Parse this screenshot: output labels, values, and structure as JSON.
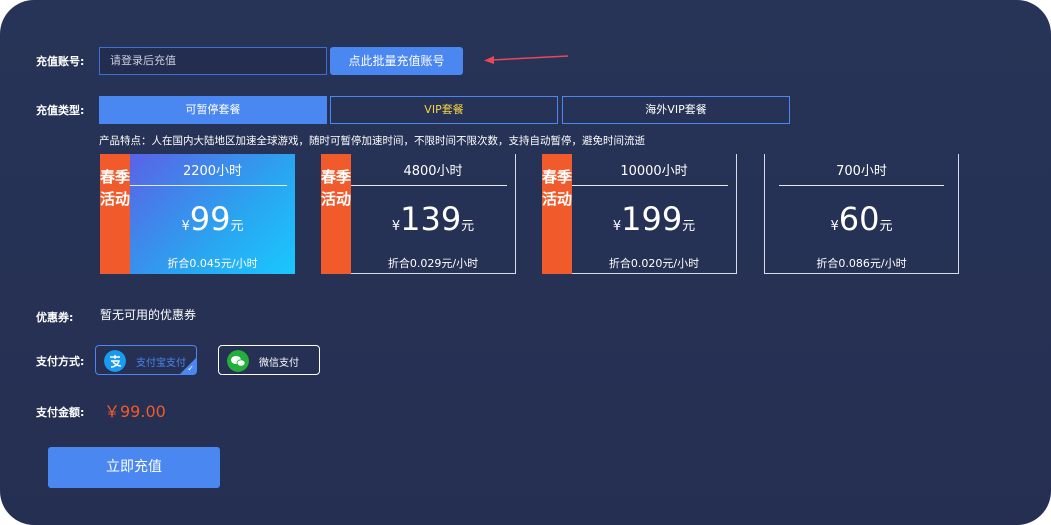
{
  "account": {
    "label": "充值账号:",
    "placeholder": "请登录后充值",
    "batch_button": "点此批量充值账号"
  },
  "type": {
    "label": "充值类型:",
    "tabs": [
      {
        "label": "可暂停套餐",
        "selected": true
      },
      {
        "label": "VIP套餐",
        "selected": false
      },
      {
        "label": "海外VIP套餐",
        "selected": false
      }
    ],
    "description": "产品特点：人在国内大陆地区加速全球游戏，随时可暂停加速时间，不限时间不限次数，支持自动暂停，避免时间流逝"
  },
  "packages": [
    {
      "badge": "春季活动",
      "hours": "2200小时",
      "yen": "¥",
      "price": "99",
      "unit": "元",
      "rate": "折合0.045元/小时",
      "selected": true
    },
    {
      "badge": "春季活动",
      "hours": "4800小时",
      "yen": "¥",
      "price": "139",
      "unit": "元",
      "rate": "折合0.029元/小时",
      "selected": false
    },
    {
      "badge": "春季活动",
      "hours": "10000小时",
      "yen": "¥",
      "price": "199",
      "unit": "元",
      "rate": "折合0.020元/小时",
      "selected": false
    },
    {
      "badge": "",
      "hours": "700小时",
      "yen": "¥",
      "price": "60",
      "unit": "元",
      "rate": "折合0.086元/小时",
      "selected": false
    }
  ],
  "coupon": {
    "label": "优惠券:",
    "value": "暂无可用的优惠券"
  },
  "payment": {
    "label": "支付方式:",
    "methods": [
      {
        "label": "支付宝支付",
        "icon": "alipay-icon",
        "color": "#1a9bf2",
        "selected": true
      },
      {
        "label": "微信支付",
        "icon": "wechat-icon",
        "color": "#22b03a",
        "selected": false
      }
    ]
  },
  "amount": {
    "label": "支付金额:",
    "value": "￥99.00"
  },
  "submit_label": "立即充值",
  "colors": {
    "accent": "#4a87f0",
    "badge": "#f15a2a",
    "vip": "#f5d342",
    "panel": "#273457"
  }
}
